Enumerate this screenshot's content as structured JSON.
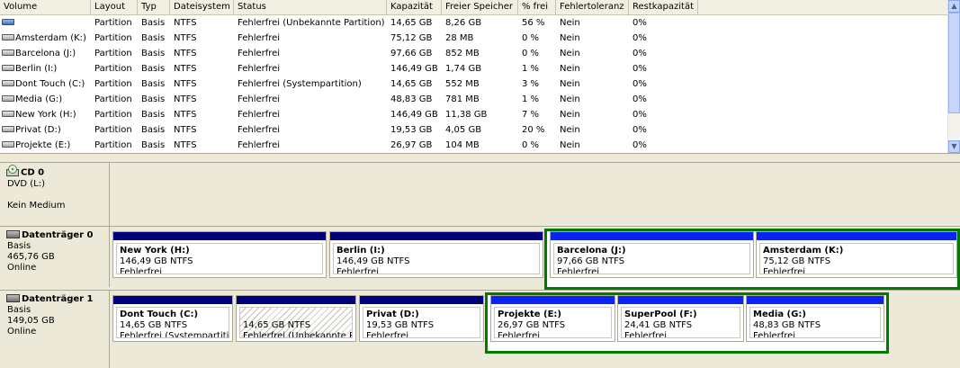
{
  "columns": [
    "Volume",
    "Layout",
    "Typ",
    "Dateisystem",
    "Status",
    "Kapazität",
    "Freier Speicher",
    "% frei",
    "Fehlertoleranz",
    "Restkapazität"
  ],
  "volumes": [
    {
      "icon": "blue-volume-icon",
      "volume": "",
      "layout": "Partition",
      "typ": "Basis",
      "fs": "NTFS",
      "status": "Fehlerfrei (Unbekannte Partition)",
      "kap": "14,65 GB",
      "frei": "8,26 GB",
      "pct": "56 %",
      "ft": "Nein",
      "rest": "0%"
    },
    {
      "icon": "drive-icon",
      "volume": "Amsterdam (K:)",
      "layout": "Partition",
      "typ": "Basis",
      "fs": "NTFS",
      "status": "Fehlerfrei",
      "kap": "75,12 GB",
      "frei": "28 MB",
      "pct": "0 %",
      "ft": "Nein",
      "rest": "0%"
    },
    {
      "icon": "drive-icon",
      "volume": "Barcelona (J:)",
      "layout": "Partition",
      "typ": "Basis",
      "fs": "NTFS",
      "status": "Fehlerfrei",
      "kap": "97,66 GB",
      "frei": "852 MB",
      "pct": "0 %",
      "ft": "Nein",
      "rest": "0%"
    },
    {
      "icon": "drive-icon",
      "volume": "Berlin (I:)",
      "layout": "Partition",
      "typ": "Basis",
      "fs": "NTFS",
      "status": "Fehlerfrei",
      "kap": "146,49 GB",
      "frei": "1,74 GB",
      "pct": "1 %",
      "ft": "Nein",
      "rest": "0%"
    },
    {
      "icon": "drive-icon",
      "volume": "Dont Touch (C:)",
      "layout": "Partition",
      "typ": "Basis",
      "fs": "NTFS",
      "status": "Fehlerfrei (Systempartition)",
      "kap": "14,65 GB",
      "frei": "552 MB",
      "pct": "3 %",
      "ft": "Nein",
      "rest": "0%"
    },
    {
      "icon": "drive-icon",
      "volume": "Media (G:)",
      "layout": "Partition",
      "typ": "Basis",
      "fs": "NTFS",
      "status": "Fehlerfrei",
      "kap": "48,83 GB",
      "frei": "781 MB",
      "pct": "1 %",
      "ft": "Nein",
      "rest": "0%"
    },
    {
      "icon": "drive-icon",
      "volume": "New York (H:)",
      "layout": "Partition",
      "typ": "Basis",
      "fs": "NTFS",
      "status": "Fehlerfrei",
      "kap": "146,49 GB",
      "frei": "11,38 GB",
      "pct": "7 %",
      "ft": "Nein",
      "rest": "0%"
    },
    {
      "icon": "drive-icon",
      "volume": "Privat (D:)",
      "layout": "Partition",
      "typ": "Basis",
      "fs": "NTFS",
      "status": "Fehlerfrei",
      "kap": "19,53 GB",
      "frei": "4,05 GB",
      "pct": "20 %",
      "ft": "Nein",
      "rest": "0%"
    },
    {
      "icon": "drive-icon",
      "volume": "Projekte (E:)",
      "layout": "Partition",
      "typ": "Basis",
      "fs": "NTFS",
      "status": "Fehlerfrei",
      "kap": "26,97 GB",
      "frei": "104 MB",
      "pct": "0 %",
      "ft": "Nein",
      "rest": "0%"
    }
  ],
  "disks": [
    {
      "icon": "cd-icon",
      "name": "CD 0",
      "line1": "DVD (L:)",
      "line2": "",
      "line3": "Kein Medium",
      "partitions": []
    },
    {
      "icon": "harddisk-icon",
      "name": "Datenträger 0",
      "line1": "Basis",
      "line2": "465,76 GB",
      "line3": "Online",
      "partitions": [
        {
          "name": "New York  (H:)",
          "size": "146,49 GB NTFS",
          "status": "Fehlerfrei",
          "kind": "primary"
        },
        {
          "name": "Berlin  (I:)",
          "size": "146,49 GB NTFS",
          "status": "Fehlerfrei",
          "kind": "primary"
        },
        {
          "name": "Barcelona  (J:)",
          "size": "97,66 GB NTFS",
          "status": "Fehlerfrei",
          "kind": "logical"
        },
        {
          "name": "Amsterdam  (K:)",
          "size": "75,12 GB NTFS",
          "status": "Fehlerfrei",
          "kind": "logical"
        }
      ]
    },
    {
      "icon": "harddisk-icon",
      "name": "Datenträger 1",
      "line1": "Basis",
      "line2": "149,05 GB",
      "line3": "Online",
      "partitions": [
        {
          "name": "Dont Touch  (C:)",
          "size": "14,65 GB NTFS",
          "status": "Fehlerfrei (Systempartitio",
          "kind": "primary"
        },
        {
          "name": "",
          "size": "14,65 GB NTFS",
          "status": "Fehlerfrei (Unbekannte Pa",
          "kind": "primary-unknown"
        },
        {
          "name": "Privat  (D:)",
          "size": "19,53 GB NTFS",
          "status": "Fehlerfrei",
          "kind": "primary"
        },
        {
          "name": "Projekte  (E:)",
          "size": "26,97 GB NTFS",
          "status": "Fehlerfrei",
          "kind": "logical"
        },
        {
          "name": "SuperPool  (F:)",
          "size": "24,41 GB NTFS",
          "status": "Fehlerfrei",
          "kind": "logical"
        },
        {
          "name": "Media  (G:)",
          "size": "48,83 GB NTFS",
          "status": "Fehlerfrei",
          "kind": "logical"
        }
      ]
    }
  ],
  "colors": {
    "primary": "#00007c",
    "logical": "#0a24f2",
    "extended": "#007a00"
  }
}
